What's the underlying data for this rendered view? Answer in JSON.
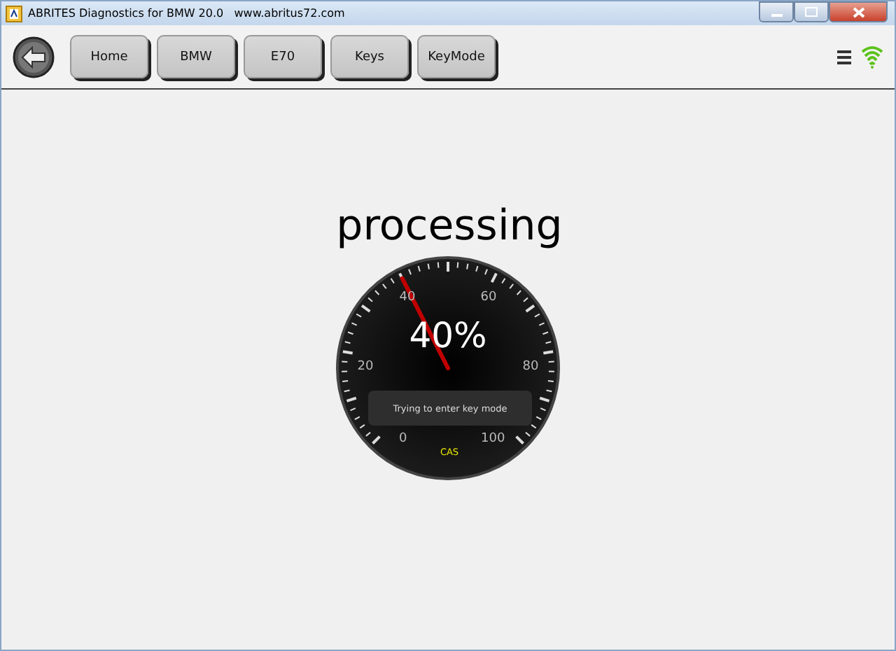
{
  "window": {
    "title": "ABRITES Diagnostics for BMW 20.0   www.abritus72.com"
  },
  "breadcrumbs": [
    {
      "label": "Home"
    },
    {
      "label": "BMW"
    },
    {
      "label": "E70"
    },
    {
      "label": "Keys"
    },
    {
      "label": "KeyMode"
    }
  ],
  "status": {
    "heading": "processing"
  },
  "gauge": {
    "level": 0.4,
    "reading": "40%",
    "scale_labels": [
      "0",
      "20",
      "40",
      "60",
      "80",
      "100"
    ],
    "message": "Trying to enter key mode",
    "module": "CAS"
  }
}
